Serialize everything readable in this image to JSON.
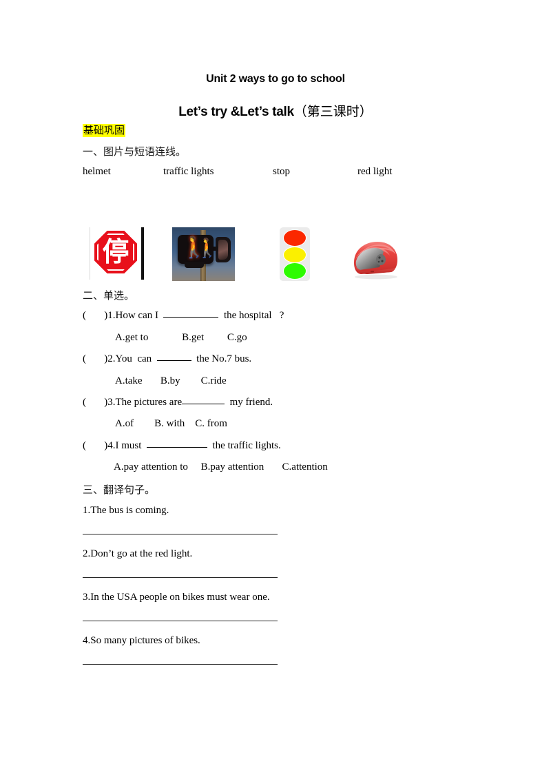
{
  "document": {
    "title_main": "Unit 2 ways to go to school",
    "title_sub_en": "Let’s try &Let’s talk",
    "title_sub_cn": "（第三课时）",
    "highlight_label": "基础巩固",
    "highlight_color": "#ffff00"
  },
  "section1": {
    "heading": "一、图片与短语连线。",
    "words": [
      "helmet",
      "traffic lights",
      "stop",
      "red light"
    ],
    "pictures": [
      {
        "name": "stop-sign",
        "glyph": "停",
        "colors": {
          "sign": "#e8101b",
          "text": "#ffffff"
        }
      },
      {
        "name": "pedestrian-signal-photo",
        "figure_red": "⬛",
        "colors": {
          "sky": "#40618a",
          "lamp": "#ff2b10"
        }
      },
      {
        "name": "traffic-light-icon",
        "colors": {
          "red": "#fb2800",
          "yellow": "#fbf000",
          "green": "#2efb00",
          "body": "#ebebeb"
        }
      },
      {
        "name": "red-helmet",
        "colors": {
          "shell": "#e8433f",
          "visor": "#4d4d4d"
        }
      }
    ]
  },
  "section2": {
    "heading": "二、单选。",
    "questions": [
      {
        "marker": "(       )",
        "number": "1.",
        "text_before": "How can I  ",
        "blank": "blank-80",
        "text_after": "  the hospital   ?",
        "options": "A.get to             B.get         C.go"
      },
      {
        "marker": "(       )",
        "number": "2.",
        "text_before": "You  can  ",
        "blank": "blank-50",
        "text_after": "  the No.7 bus.",
        "options": "A.take       B.by        C.ride"
      },
      {
        "marker": "(       )",
        "number": "3.",
        "text_before": "The pictures are",
        "blank": "blank-62",
        "text_after": "  my friend.",
        "options": "A.of        B. with    C. from"
      },
      {
        "marker": "(       )",
        "number": "4.",
        "text_before": "I must  ",
        "blank": "blank-88",
        "text_after": "  the traffic lights.",
        "options": "A.pay attention to     B.pay attention       C.attention"
      }
    ]
  },
  "section3": {
    "heading": "三、翻译句子。",
    "sentences": [
      "1.The bus is coming.",
      "2.Don’t go at the red light.",
      "3.In the USA people on bikes must wear one.",
      "4.So many pictures of bikes."
    ]
  }
}
